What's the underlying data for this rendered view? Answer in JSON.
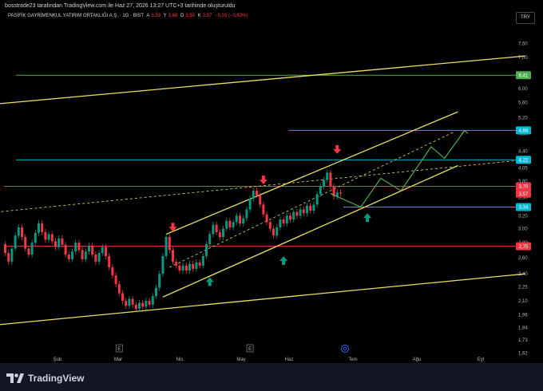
{
  "header": {
    "publisher_line": "bosstrade23 tarafından TradingView.com ile Haz 27, 2026 13:27 UTC+3 tarihinde oluşturuldu"
  },
  "symbol": {
    "name": "PASİFİK GAYRİMENKUL YATIRIM ORTAKLIĞI A.Ş. · 1G · BIST",
    "o_label": "A",
    "o_value": "3,59",
    "h_label": "Y",
    "h_value": "3,68",
    "l_label": "D",
    "l_value": "3,50",
    "c_label": "K",
    "c_value": "3,57",
    "change": "−0,03 (−0,83%)"
  },
  "currency": "TRY",
  "brand": {
    "name": "TradingView"
  },
  "colors": {
    "background": "#000000",
    "up": "#089981",
    "down": "#f23645",
    "yellow": "#e8e065",
    "green_level": "#4caf50",
    "cyan_level": "#00bcd4",
    "red_level": "#f23645",
    "projection": "#4caf50"
  },
  "chart_data": {
    "type": "candlestick",
    "scale": "log",
    "y_ticks": [
      "7,50",
      "7,00",
      "6,00",
      "5,60",
      "5,20",
      "4,80",
      "4,40",
      "4,05",
      "3,80",
      "3,50",
      "3,20",
      "3,00",
      "2,80",
      "2,60",
      "2,40",
      "2,25",
      "2,10",
      "1,96",
      "1,84",
      "1,73",
      "1,62"
    ],
    "x_ticks": [
      "Şub",
      "Mar",
      "Nis",
      "May",
      "Haz",
      "Tem",
      "Ağu",
      "Eyl"
    ],
    "price_labels": [
      {
        "value": "6,41",
        "color": "#4caf50"
      },
      {
        "value": "4,88",
        "color": "#00bcd4"
      },
      {
        "value": "4,22",
        "color": "#00bcd4"
      },
      {
        "value": "3,70",
        "color": "#f23645"
      },
      {
        "value": "3,57",
        "color": "#f23645"
      },
      {
        "value": "3,34",
        "color": "#00bcd4"
      },
      {
        "value": "2,75",
        "color": "#f23645"
      }
    ],
    "horizontal_levels": [
      6.41,
      4.88,
      4.22,
      3.7,
      3.34,
      2.75
    ],
    "candles": [
      [
        2.78,
        2.66
      ],
      [
        2.66,
        2.55
      ],
      [
        2.55,
        2.72
      ],
      [
        2.72,
        2.9
      ],
      [
        2.9,
        3.02
      ],
      [
        3.02,
        2.88
      ],
      [
        2.88,
        2.72
      ],
      [
        2.72,
        2.64
      ],
      [
        2.64,
        2.8
      ],
      [
        2.8,
        2.94
      ],
      [
        2.94,
        3.08
      ],
      [
        3.08,
        2.95
      ],
      [
        2.95,
        2.84
      ],
      [
        2.84,
        2.92
      ],
      [
        2.92,
        2.82
      ],
      [
        2.82,
        2.74
      ],
      [
        2.74,
        2.86
      ],
      [
        2.86,
        2.77
      ],
      [
        2.77,
        2.64
      ],
      [
        2.64,
        2.58
      ],
      [
        2.58,
        2.68
      ],
      [
        2.68,
        2.8
      ],
      [
        2.8,
        2.7
      ],
      [
        2.7,
        2.58
      ],
      [
        2.58,
        2.68
      ],
      [
        2.68,
        2.76
      ],
      [
        2.76,
        2.64
      ],
      [
        2.64,
        2.55
      ],
      [
        2.55,
        2.66
      ],
      [
        2.66,
        2.74
      ],
      [
        2.74,
        2.62
      ],
      [
        2.62,
        2.48
      ],
      [
        2.48,
        2.38
      ],
      [
        2.38,
        2.28
      ],
      [
        2.28,
        2.18
      ],
      [
        2.18,
        2.1
      ],
      [
        2.1,
        2.05
      ],
      [
        2.05,
        2.12
      ],
      [
        2.12,
        2.06
      ],
      [
        2.06,
        2.02
      ],
      [
        2.02,
        2.08
      ],
      [
        2.08,
        2.04
      ],
      [
        2.04,
        2.1
      ],
      [
        2.1,
        2.06
      ],
      [
        2.06,
        2.15
      ],
      [
        2.15,
        2.24
      ],
      [
        2.24,
        2.4
      ],
      [
        2.4,
        2.62
      ],
      [
        2.62,
        2.88
      ],
      [
        2.88,
        2.7
      ],
      [
        2.7,
        2.55
      ],
      [
        2.55,
        2.5
      ],
      [
        2.5,
        2.44
      ],
      [
        2.44,
        2.5
      ],
      [
        2.5,
        2.44
      ],
      [
        2.44,
        2.52
      ],
      [
        2.52,
        2.46
      ],
      [
        2.46,
        2.54
      ],
      [
        2.54,
        2.5
      ],
      [
        2.5,
        2.62
      ],
      [
        2.62,
        2.78
      ],
      [
        2.78,
        2.92
      ],
      [
        2.92,
        3.06
      ],
      [
        3.06,
        2.95
      ],
      [
        2.95,
        2.88
      ],
      [
        2.88,
        3.0
      ],
      [
        3.0,
        3.12
      ],
      [
        3.12,
        3.02
      ],
      [
        3.02,
        3.1
      ],
      [
        3.1,
        3.2
      ],
      [
        3.2,
        3.08
      ],
      [
        3.08,
        3.16
      ],
      [
        3.16,
        3.3
      ],
      [
        3.3,
        3.48
      ],
      [
        3.48,
        3.62
      ],
      [
        3.62,
        3.54
      ],
      [
        3.54,
        3.38
      ],
      [
        3.38,
        3.22
      ],
      [
        3.22,
        3.1
      ],
      [
        3.1,
        3.0
      ],
      [
        3.0,
        2.9
      ],
      [
        2.9,
        3.02
      ],
      [
        3.02,
        3.14
      ],
      [
        3.14,
        3.08
      ],
      [
        3.08,
        3.2
      ],
      [
        3.2,
        3.14
      ],
      [
        3.14,
        3.26
      ],
      [
        3.26,
        3.2
      ],
      [
        3.2,
        3.3
      ],
      [
        3.3,
        3.24
      ],
      [
        3.24,
        3.36
      ],
      [
        3.36,
        3.28
      ],
      [
        3.28,
        3.38
      ],
      [
        3.38,
        3.56
      ],
      [
        3.56,
        3.7
      ],
      [
        3.7,
        3.82
      ],
      [
        3.82,
        3.96
      ],
      [
        3.96,
        3.7
      ],
      [
        3.7,
        3.52
      ],
      [
        3.52,
        3.59
      ],
      [
        3.59,
        3.57
      ]
    ],
    "trend_lines": [
      {
        "name": "upper-long",
        "points": [
          [
            -4,
            5.55
          ],
          [
            155,
            7.05
          ]
        ]
      },
      {
        "name": "lower-long",
        "points": [
          [
            -4,
            1.86
          ],
          [
            155,
            2.4
          ]
        ]
      },
      {
        "name": "channel-upper",
        "points": [
          [
            48,
            2.92
          ],
          [
            135,
            5.35
          ]
        ]
      },
      {
        "name": "channel-lower",
        "points": [
          [
            47,
            2.14
          ],
          [
            135,
            4.1
          ]
        ]
      },
      {
        "name": "dashed-1",
        "points": [
          [
            -4,
            3.25
          ],
          [
            155,
            4.22
          ]
        ]
      },
      {
        "name": "dashed-2",
        "points": [
          [
            49,
            2.48
          ],
          [
            134,
            4.85
          ]
        ]
      }
    ],
    "projection_path": [
      [
        97,
        3.57
      ],
      [
        106,
        3.34
      ],
      [
        112,
        3.85
      ],
      [
        118,
        3.62
      ],
      [
        127,
        4.5
      ],
      [
        131,
        4.25
      ],
      [
        137,
        4.88
      ]
    ],
    "arrows_down": [
      [
        50,
        2.97
      ],
      [
        77,
        3.75
      ],
      [
        99,
        4.36
      ]
    ],
    "arrows_up": [
      [
        61,
        2.36
      ],
      [
        83,
        2.62
      ],
      [
        108,
        3.24
      ]
    ],
    "event_markers": [
      {
        "text": "E",
        "x": 34
      },
      {
        "text": "E",
        "x": 73
      }
    ]
  }
}
